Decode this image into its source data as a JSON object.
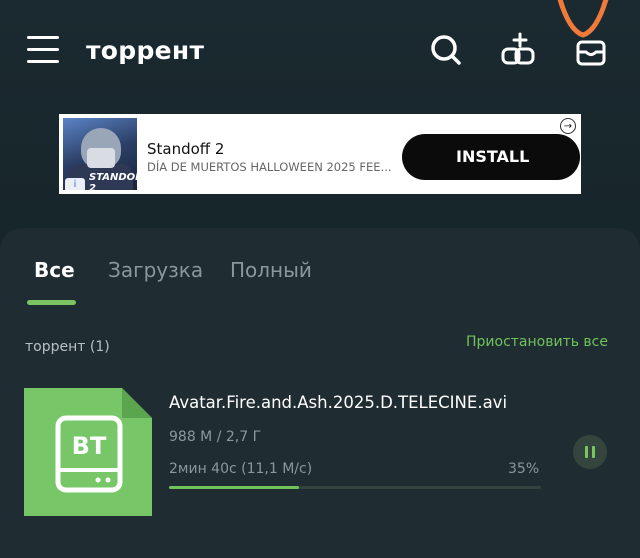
{
  "appbar": {
    "title": "торрент"
  },
  "ad": {
    "title": "Standoff 2",
    "subtitle": "DÍA DE MUERTOS HALLOWEEN 2025 FEE...",
    "install_label": "INSTALL",
    "image_logo_text": "STANDOFF 2",
    "info_glyph": "i",
    "adchoice_glyph": "→"
  },
  "tabs": [
    {
      "label": "Все",
      "active": true
    },
    {
      "label": "Загрузка",
      "active": false
    },
    {
      "label": "Полный",
      "active": false
    }
  ],
  "section": {
    "label": "торрент (1)",
    "pause_all_label": "Приостановить все"
  },
  "download": {
    "icon_text": "BT",
    "name": "Avatar.Fire.and.Ash.2025.D.TELECINE.avi",
    "size": "988 М / 2,7 Г",
    "eta_speed": "2мин 40с  (11,1 М/с)",
    "percent": "35%",
    "progress": 0.35
  },
  "colors": {
    "accent": "#6fc35a",
    "background": "#17262b",
    "panel": "#1f2c31",
    "annotation": "#f07a3a"
  },
  "icons": [
    "menu-icon",
    "search-icon",
    "add-link-icon",
    "inbox-icon",
    "pause-icon"
  ]
}
